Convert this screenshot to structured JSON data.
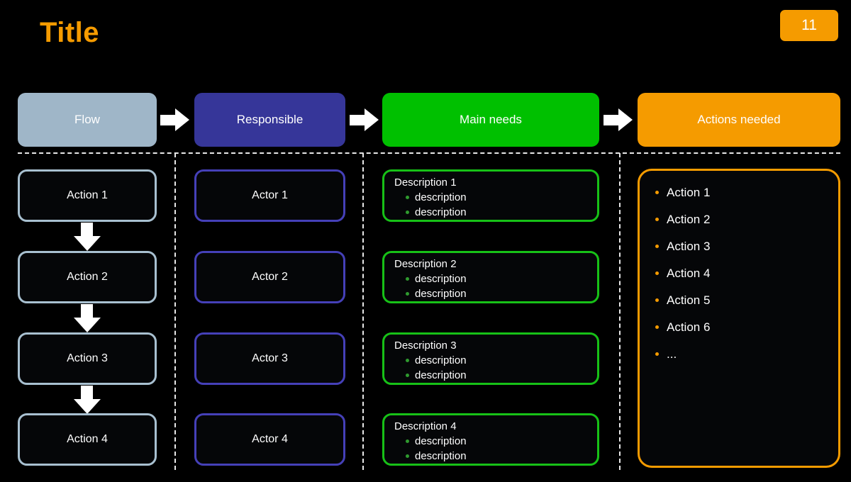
{
  "slide": {
    "title": "Title",
    "page_number": "11",
    "accent_color": "#F59B00",
    "background_color": "#000000"
  },
  "header": {
    "columns": [
      {
        "label": "Flow",
        "color": "#9FB6C8"
      },
      {
        "label": "Responsible",
        "color": "#363699"
      },
      {
        "label": "Main needs",
        "color": "#00C000"
      },
      {
        "label": "Actions needed",
        "color": "#F59B00"
      }
    ],
    "arrow_icon": "arrow-right-icon"
  },
  "flow_column": {
    "border_color": "#A8C0D0",
    "arrow_icon": "arrow-down-icon",
    "items": [
      {
        "label": "Action 1"
      },
      {
        "label": "Action 2"
      },
      {
        "label": "Action 3"
      },
      {
        "label": "Action 4"
      }
    ]
  },
  "responsible_column": {
    "border_color": "#4540B8",
    "items": [
      {
        "label": "Actor 1"
      },
      {
        "label": "Actor 2"
      },
      {
        "label": "Actor 3"
      },
      {
        "label": "Actor 4"
      }
    ]
  },
  "main_needs_column": {
    "border_color": "#17C117",
    "bullet_color": "#2F9B2F",
    "items": [
      {
        "title": "Description 1",
        "bullets": [
          "description",
          "description"
        ]
      },
      {
        "title": "Description 2",
        "bullets": [
          "description",
          "description"
        ]
      },
      {
        "title": "Description 3",
        "bullets": [
          "description",
          "description"
        ]
      },
      {
        "title": "Description 4",
        "bullets": [
          "description",
          "description"
        ]
      }
    ]
  },
  "actions_column": {
    "border_color": "#F59B00",
    "bullet_color": "#F59B00",
    "items": [
      {
        "label": "Action 1"
      },
      {
        "label": "Action 2"
      },
      {
        "label": "Action 3"
      },
      {
        "label": "Action 4"
      },
      {
        "label": "Action 5"
      },
      {
        "label": "Action 6"
      },
      {
        "label": "..."
      }
    ]
  }
}
